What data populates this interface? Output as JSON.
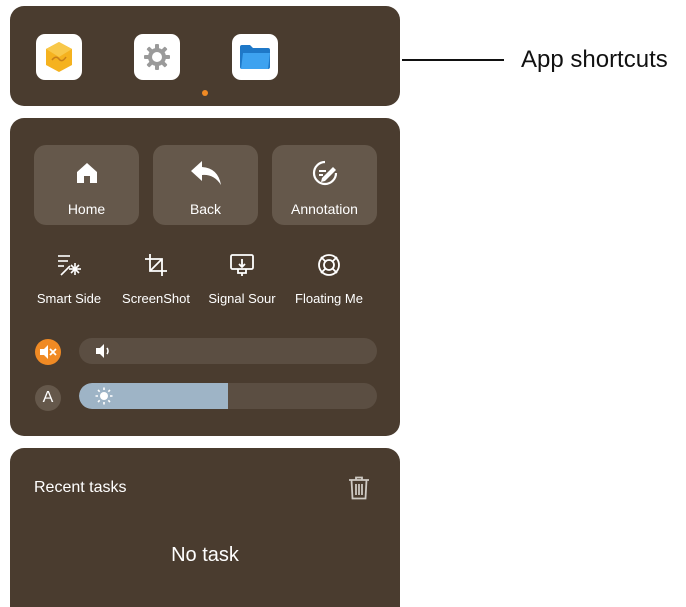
{
  "shortcuts": {
    "apps": [
      {
        "icon": "whiteboard-app-icon"
      },
      {
        "icon": "settings-gear-icon"
      },
      {
        "icon": "folder-icon"
      }
    ],
    "page_indicator_color": "#f08a24"
  },
  "controls": {
    "primary_buttons": [
      {
        "label": "Home",
        "icon": "home-icon"
      },
      {
        "label": "Back",
        "icon": "back-arrow-icon"
      },
      {
        "label": "Annotation",
        "icon": "annotation-pen-icon"
      }
    ],
    "secondary_buttons": [
      {
        "label": "Smart Side",
        "icon": "magic-wand-icon"
      },
      {
        "label": "ScreenShot",
        "icon": "crop-icon"
      },
      {
        "label": "Signal Sour",
        "icon": "signal-source-icon"
      },
      {
        "label": "Floating Me",
        "icon": "floating-menu-icon"
      }
    ],
    "volume": {
      "muted": true,
      "level_percent": 0
    },
    "brightness": {
      "auto_label": "A",
      "level_percent": 50
    }
  },
  "recent_tasks": {
    "title": "Recent tasks",
    "empty_message": "No task"
  },
  "annotation": {
    "callout": "App shortcuts"
  }
}
